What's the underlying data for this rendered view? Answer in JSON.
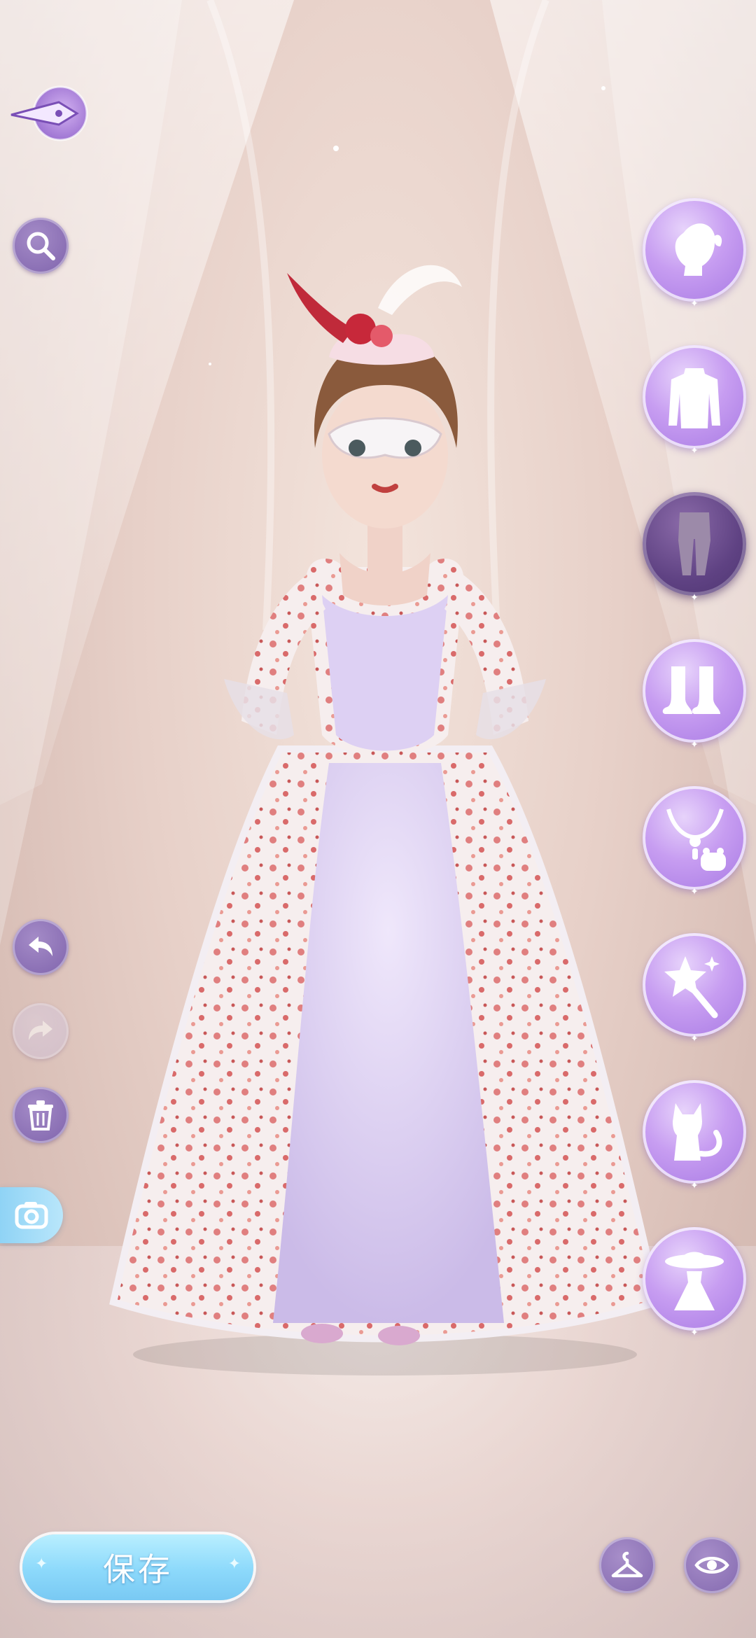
{
  "toolbar": {
    "save_label": "保存"
  },
  "left_tools": [
    {
      "name": "pen",
      "icon": "pen-nib-icon"
    },
    {
      "name": "search",
      "icon": "search-icon"
    },
    {
      "name": "undo",
      "icon": "undo-icon"
    },
    {
      "name": "redo",
      "icon": "redo-icon",
      "enabled": false
    },
    {
      "name": "delete",
      "icon": "trash-icon"
    },
    {
      "name": "camera",
      "icon": "camera-icon"
    }
  ],
  "categories": [
    {
      "name": "hair",
      "icon": "hairstyle-icon",
      "active": false
    },
    {
      "name": "top",
      "icon": "top-clothing-icon",
      "active": false
    },
    {
      "name": "bottom",
      "icon": "legwear-icon",
      "active": true
    },
    {
      "name": "shoes",
      "icon": "shoes-icon",
      "active": false
    },
    {
      "name": "accessories",
      "icon": "jewelry-bag-icon",
      "active": false
    },
    {
      "name": "wand",
      "icon": "magic-wand-icon",
      "active": false
    },
    {
      "name": "pet",
      "icon": "cat-icon",
      "active": false
    },
    {
      "name": "outfit",
      "icon": "dress-hat-icon",
      "active": false
    }
  ],
  "bottom_tools": [
    {
      "name": "hanger",
      "icon": "hanger-icon"
    },
    {
      "name": "preview",
      "icon": "eye-icon"
    }
  ],
  "colors": {
    "accent_purple": "#a779e3",
    "button_purple": "#8a6fb4",
    "save_blue": "#8cd9fb"
  }
}
